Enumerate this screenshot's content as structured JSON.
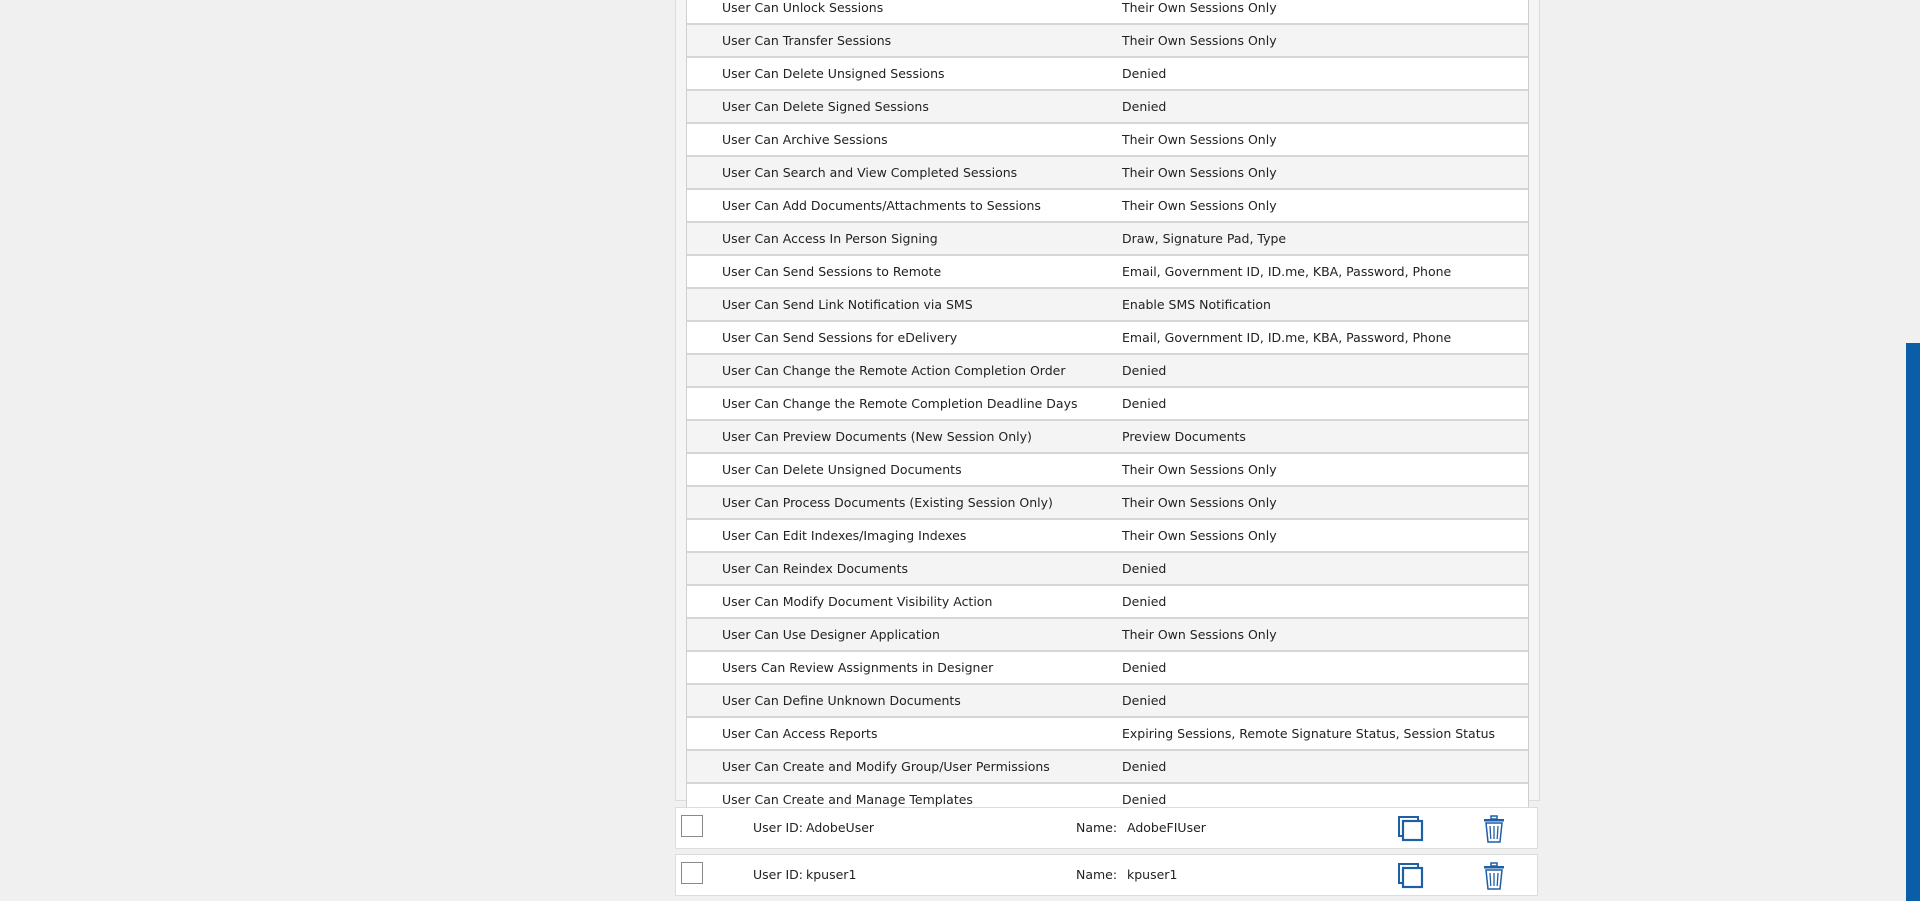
{
  "permissions": [
    {
      "name": "User Can Unlock Sessions",
      "value": "Their Own Sessions Only"
    },
    {
      "name": "User Can Transfer Sessions",
      "value": "Their Own Sessions Only"
    },
    {
      "name": "User Can Delete Unsigned Sessions",
      "value": "Denied"
    },
    {
      "name": "User Can Delete Signed Sessions",
      "value": "Denied"
    },
    {
      "name": "User Can Archive Sessions",
      "value": "Their Own Sessions Only"
    },
    {
      "name": "User Can Search and View Completed Sessions",
      "value": "Their Own Sessions Only"
    },
    {
      "name": "User Can Add Documents/Attachments to Sessions",
      "value": "Their Own Sessions Only"
    },
    {
      "name": "User Can Access In Person Signing",
      "value": "Draw, Signature Pad, Type"
    },
    {
      "name": "User Can Send Sessions to Remote",
      "value": "Email, Government ID, ID.me, KBA, Password, Phone"
    },
    {
      "name": "User Can Send Link Notification via SMS",
      "value": "Enable SMS Notification"
    },
    {
      "name": "User Can Send Sessions for eDelivery",
      "value": "Email, Government ID, ID.me, KBA, Password, Phone"
    },
    {
      "name": "User Can Change the Remote Action Completion Order",
      "value": "Denied"
    },
    {
      "name": "User Can Change the Remote Completion Deadline Days",
      "value": "Denied"
    },
    {
      "name": "User Can Preview Documents (New Session Only)",
      "value": "Preview Documents"
    },
    {
      "name": "User Can Delete Unsigned Documents",
      "value": "Their Own Sessions Only"
    },
    {
      "name": "User Can Process Documents (Existing Session Only)",
      "value": "Their Own Sessions Only"
    },
    {
      "name": "User Can Edit Indexes/Imaging Indexes",
      "value": "Their Own Sessions Only"
    },
    {
      "name": "User Can Reindex Documents",
      "value": "Denied"
    },
    {
      "name": "User Can Modify Document Visibility Action",
      "value": "Denied"
    },
    {
      "name": "User Can Use Designer Application",
      "value": "Their Own Sessions Only"
    },
    {
      "name": "Users Can Review Assignments in Designer",
      "value": "Denied"
    },
    {
      "name": "User Can Define Unknown Documents",
      "value": "Denied"
    },
    {
      "name": "User Can Access Reports",
      "value": "Expiring Sessions, Remote Signature Status, Session Status"
    },
    {
      "name": "User Can Create and Modify Group/User Permissions",
      "value": "Denied"
    },
    {
      "name": "User Can Create and Manage Templates",
      "value": "Denied"
    }
  ],
  "users": [
    {
      "user_id_label": "User ID:",
      "user_id": "AdobeUser",
      "name_label": "Name:",
      "name": "AdobeFIUser"
    },
    {
      "user_id_label": "User ID:",
      "user_id": "kpuser1",
      "name_label": "Name:",
      "name": "kpuser1"
    }
  ],
  "colors": {
    "accent": "#0a5ea8",
    "icon_blue": "#1f5fa6"
  },
  "icons": {
    "copy": "copy-icon",
    "delete": "trash-icon"
  }
}
